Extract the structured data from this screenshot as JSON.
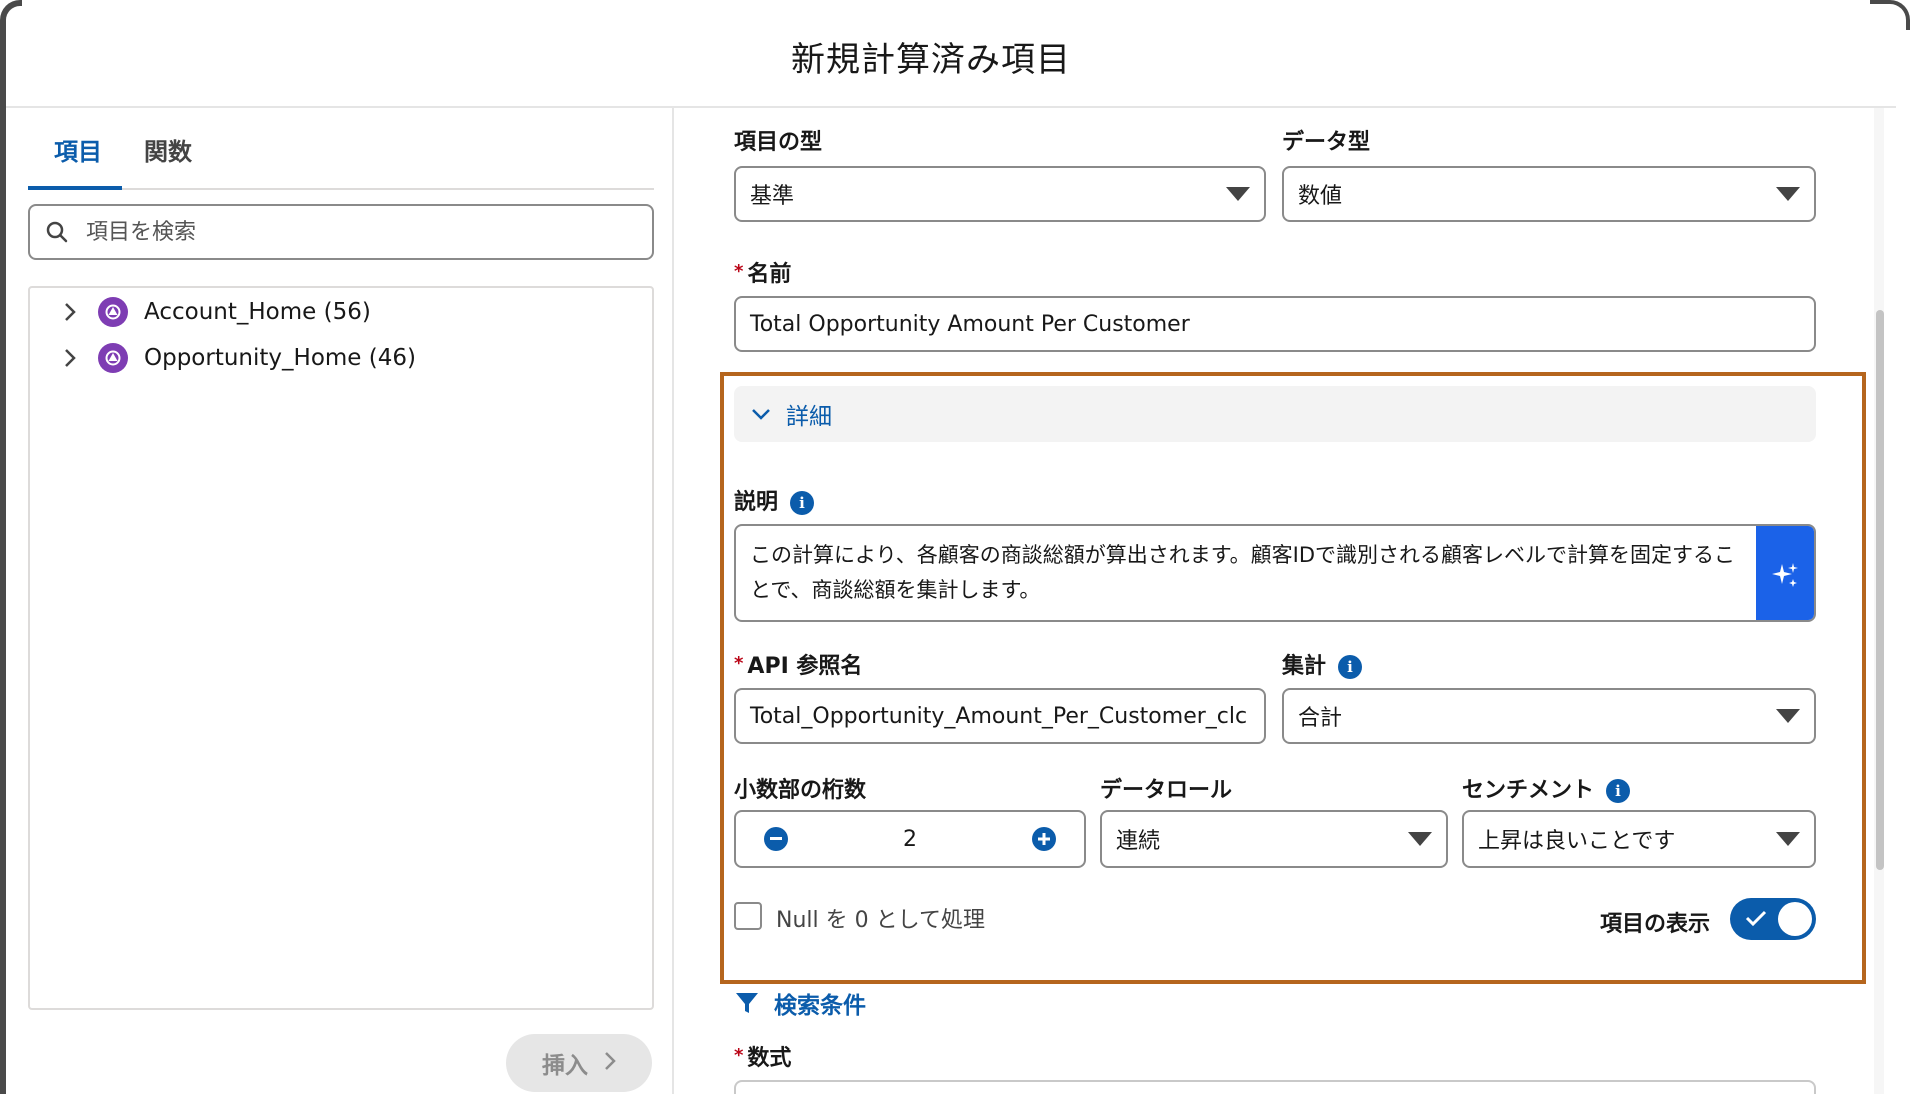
{
  "modal": {
    "title": "新規計算済み項目"
  },
  "left_panel": {
    "tabs": [
      {
        "label": "項目",
        "active": true
      },
      {
        "label": "関数",
        "active": false
      }
    ],
    "search": {
      "placeholder": "項目を検索",
      "value": ""
    },
    "tree_items": [
      {
        "label": "Account_Home (56)"
      },
      {
        "label": "Opportunity_Home (46)"
      }
    ],
    "insert_label": "挿入"
  },
  "form": {
    "field_type": {
      "label": "項目の型",
      "value": "基準"
    },
    "data_type": {
      "label": "データ型",
      "value": "数値"
    },
    "name": {
      "label": "名前",
      "value": "Total Opportunity Amount Per Customer"
    },
    "details": {
      "title": "詳細",
      "description": {
        "label": "説明",
        "value": "この計算により、各顧客の商談総額が算出されます。顧客IDで識別される顧客レベルで計算を固定することで、商談総額を集計します。"
      },
      "api_name": {
        "label": "API 参照名",
        "value": "Total_Opportunity_Amount_Per_Customer_clc"
      },
      "aggregation": {
        "label": "集計",
        "value": "合計"
      },
      "decimals": {
        "label": "小数部の桁数",
        "value": "2"
      },
      "data_role": {
        "label": "データロール",
        "value": "連続"
      },
      "sentiment": {
        "label": "センチメント",
        "value": "上昇は良いことです"
      },
      "null_as_zero": {
        "label": "Null を 0 として処理",
        "checked": false
      },
      "show_field": {
        "label": "項目の表示",
        "on": true
      }
    },
    "filter_label": "検索条件",
    "formula_label": "数式"
  },
  "colors": {
    "accent": "#0b5cab",
    "highlight_frame": "#b5651d",
    "ai_button": "#1b62e8",
    "dataset_icon": "#7e3db3",
    "required": "#ba0517"
  }
}
